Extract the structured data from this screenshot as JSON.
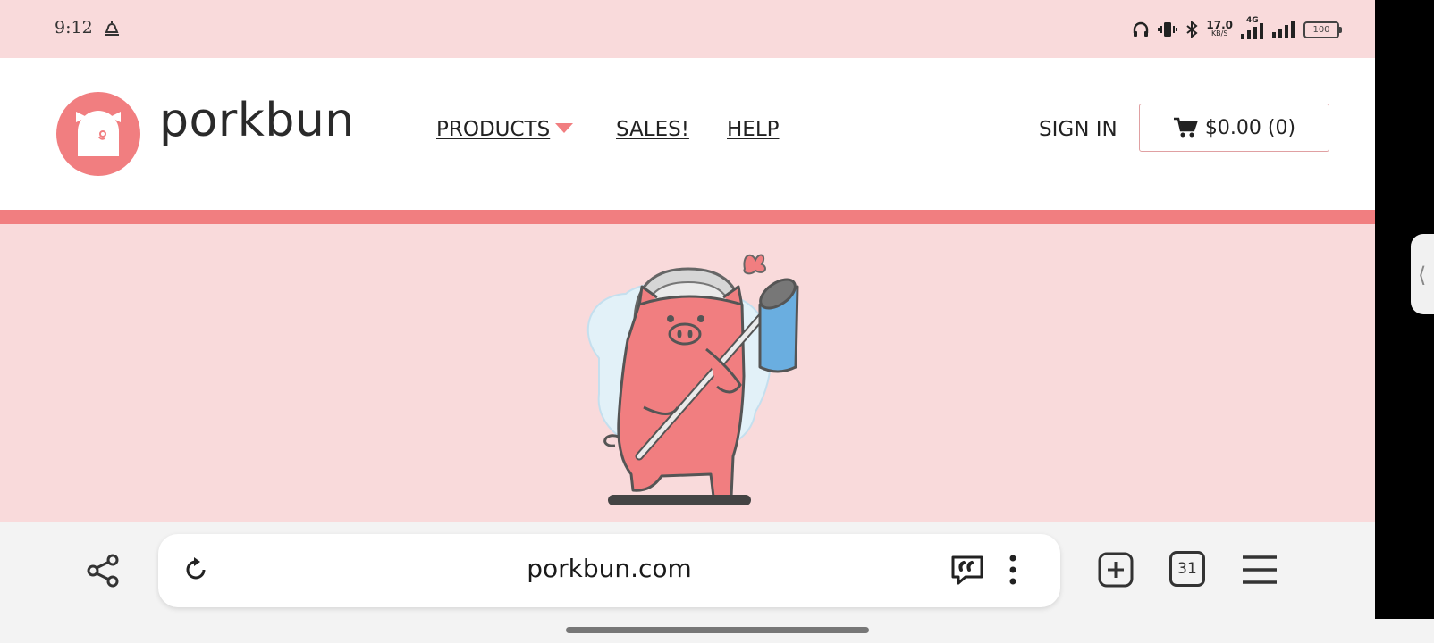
{
  "status_bar": {
    "time": "9:12",
    "speed_value": "17.0",
    "speed_unit": "KB/S",
    "network": "4G",
    "battery": "100"
  },
  "header": {
    "brand": "porkbun",
    "nav": {
      "products": "PRODUCTS",
      "sales": "SALES!",
      "help": "HELP"
    },
    "sign_in": "SIGN IN",
    "cart_label": "$0.00 (0)"
  },
  "browser": {
    "url": "porkbun.com",
    "tab_count": "31"
  },
  "colors": {
    "brand_pink": "#f17e80",
    "light_pink": "#f9dadb",
    "net_blue": "#6aaee0"
  }
}
